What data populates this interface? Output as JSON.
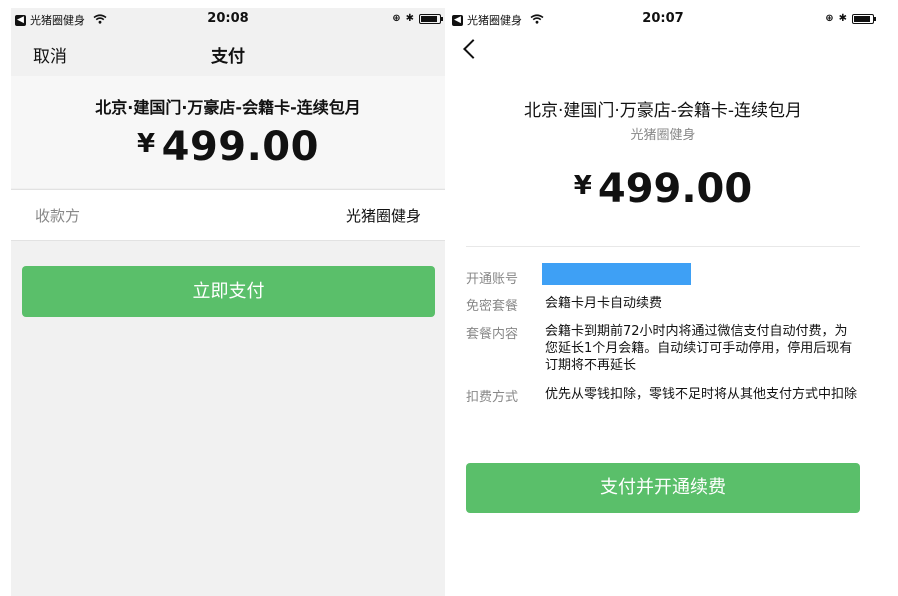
{
  "left_screen": {
    "status": {
      "carrier": "光猪圈健身",
      "time": "20:08"
    },
    "nav": {
      "cancel": "取消",
      "title": "支付"
    },
    "product_name": "北京·建国门·万豪店-会籍卡-连续包月",
    "currency": "¥",
    "amount": "499.00",
    "payee_label": "收款方",
    "payee_value": "光猪圈健身",
    "pay_button": "立即支付"
  },
  "right_screen": {
    "status": {
      "carrier": "光猪圈健身",
      "time": "20:07"
    },
    "product_name": "北京·建国门·万豪店-会籍卡-连续包月",
    "merchant": "光猪圈健身",
    "currency": "¥",
    "amount": "499.00",
    "rows": [
      {
        "label": "开通账号",
        "value": ""
      },
      {
        "label": "免密套餐",
        "value": "会籍卡月卡自动续费"
      },
      {
        "label": "套餐内容",
        "value": "会籍卡到期前72小时内将通过微信支付自动付费，为您延长1个月会籍。自动续订可手动停用，停用后现有订期将不再延长"
      },
      {
        "label": "扣费方式",
        "value": "优先从零钱扣除，零钱不足时将从其他支付方式中扣除"
      }
    ],
    "pay_button": "支付并开通续费"
  },
  "colors": {
    "accent_green": "#5abf6a",
    "account_mask_blue": "#3ea0f5"
  },
  "icons": [
    "back-app-icon",
    "wifi-icon",
    "orientation-lock-icon",
    "bluetooth-icon",
    "battery-icon",
    "back-chevron-icon"
  ]
}
